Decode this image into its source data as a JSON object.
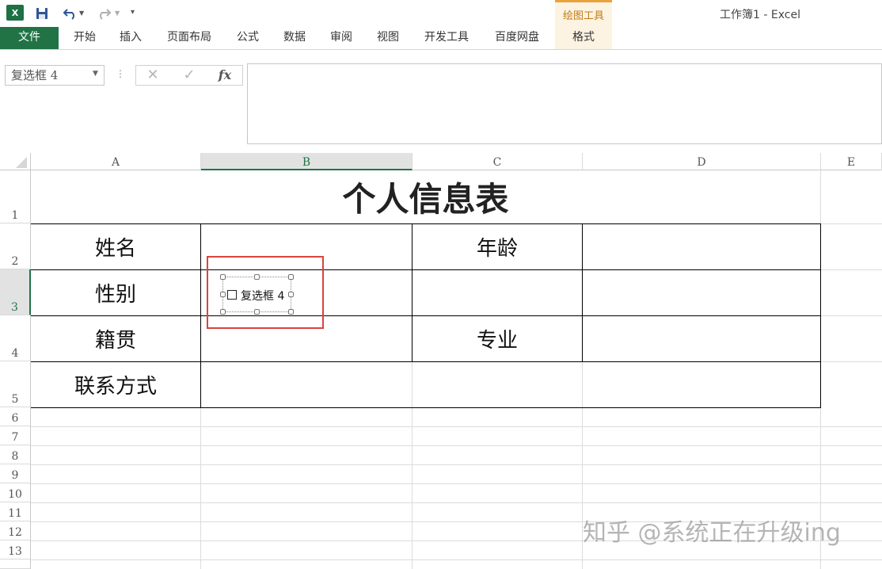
{
  "window": {
    "title": "工作簿1 - Excel",
    "app_icon": "X",
    "contextual_group": "绘图工具"
  },
  "quick_access": {
    "icons": [
      "excel-logo-icon",
      "save-icon",
      "undo-icon",
      "redo-icon",
      "customize-icon"
    ]
  },
  "ribbon": {
    "file_tab": "文件",
    "tabs": [
      "开始",
      "插入",
      "页面布局",
      "公式",
      "数据",
      "审阅",
      "视图",
      "开发工具",
      "百度网盘"
    ],
    "format_tab": "格式"
  },
  "formula_bar": {
    "name_box": "复选框 4",
    "cancel_symbol": "✕",
    "enter_symbol": "✓",
    "fx_symbol": "fx",
    "value": ""
  },
  "grid": {
    "columns": [
      "A",
      "B",
      "C",
      "D",
      "E"
    ],
    "selected_column": "B",
    "rows": [
      "1",
      "2",
      "3",
      "4",
      "5",
      "6",
      "7",
      "8",
      "9",
      "10",
      "11",
      "12",
      "13"
    ],
    "selected_row": "3"
  },
  "sheet": {
    "title": "个人信息表",
    "labels": {
      "name": "姓名",
      "age": "年龄",
      "gender": "性别",
      "hometown": "籍贯",
      "major": "专业",
      "contact": "联系方式"
    }
  },
  "checkbox": {
    "label": "复选框 4",
    "checked": false
  },
  "watermark": "知乎 @系统正在升级ing",
  "colors": {
    "excel_green": "#217346",
    "drawing_tools_accent": "#e8a33c",
    "highlight_red": "#d9443f"
  }
}
